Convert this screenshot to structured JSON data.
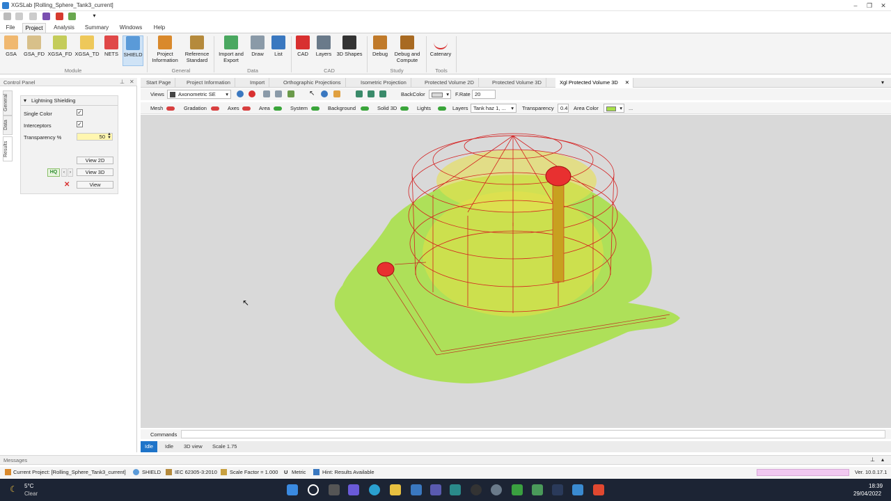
{
  "window": {
    "title": "XGSLab [Rolling_Sphere_Tank3_current]"
  },
  "ribbon_tabs": [
    {
      "label": "File"
    },
    {
      "label": "Project"
    },
    {
      "label": "Analysis"
    },
    {
      "label": "Summary"
    },
    {
      "label": "Windows"
    },
    {
      "label": "Help"
    }
  ],
  "ribbon": {
    "module": {
      "label": "Module",
      "items": [
        "GSA",
        "GSA_FD",
        "XGSA_FD",
        "XGSA_TD",
        "NETS",
        "SHIELD"
      ]
    },
    "general": {
      "label": "General",
      "items": [
        "Project Information",
        "Reference Standard"
      ]
    },
    "data": {
      "label": "Data",
      "items": [
        "Import and Export",
        "Draw",
        "List"
      ]
    },
    "cad": {
      "label": "CAD",
      "items": [
        "CAD",
        "Layers",
        "3D Shapes"
      ]
    },
    "study": {
      "label": "Study",
      "items": [
        "Debug",
        "Debug and Compute"
      ]
    },
    "tools": {
      "label": "Tools",
      "items": [
        "Catenary"
      ]
    }
  },
  "control_panel": {
    "title": "Control Panel",
    "side_tabs": [
      "General",
      "Data",
      "Results"
    ],
    "group_title": "Lightning Shielding",
    "single_color_label": "Single Color",
    "interceptors_label": "Interceptors",
    "transparency_label": "Transparency %",
    "transparency_value": "50",
    "single_color_checked": true,
    "interceptors_checked": true,
    "view2d_label": "View 2D",
    "view3d_label": "View 3D",
    "view_label": "View",
    "hq_label": "HQ"
  },
  "doc_tabs": [
    "Start Page",
    "Project Information",
    "Import",
    "Orthographic Projections",
    "Isometric Projection",
    "Protected Volume 2D",
    "Protected Volume 3D",
    "Xgl Protected Volume 3D"
  ],
  "toolbar1": {
    "views_label": "Views",
    "views_value": "Axonometric SE",
    "backcolor_label": "BackColor",
    "frate_label": "F.Rate",
    "frate_value": "20"
  },
  "toolbar2": {
    "mesh_label": "Mesh",
    "gradation_label": "Gradation",
    "axes_label": "Axes",
    "area_label": "Area",
    "system_label": "System",
    "background_label": "Background",
    "solid3d_label": "Solid 3D",
    "lights_label": "Lights",
    "layers_label": "Layers",
    "layers_value": "Tank haz 1, ...",
    "transparency_label": "Transparency",
    "transparency_value": "0.4",
    "areacolor_label": "Area Color",
    "more_label": "...",
    "toggles": {
      "mesh": false,
      "gradation": false,
      "axes": false,
      "area": true,
      "system": true,
      "background": true,
      "solid3d": true,
      "lights": true
    }
  },
  "commands_label": "Commands",
  "status": [
    "Idle",
    "Idle",
    "3D view",
    "Scale 1.75"
  ],
  "messages_label": "Messages",
  "bottom_bar": {
    "project": "Current Project: [Rolling_Sphere_Tank3_current]",
    "module": "SHIELD",
    "standard": "IEC 62305-3:2010",
    "scale": "Scale Factor = 1.000",
    "units": "Metric",
    "hint": "Hint: Results Available",
    "version": "Ver. 10.0.17.1"
  },
  "taskbar": {
    "weather_temp": "5°C",
    "weather_desc": "Clear",
    "time": "18:39",
    "date": "29/04/2022"
  },
  "colors": {
    "accent": "#1e74c9",
    "protected_area": "#a8e04a",
    "wireframe": "#d42020",
    "viewport_bg": "#d9d9d9"
  }
}
